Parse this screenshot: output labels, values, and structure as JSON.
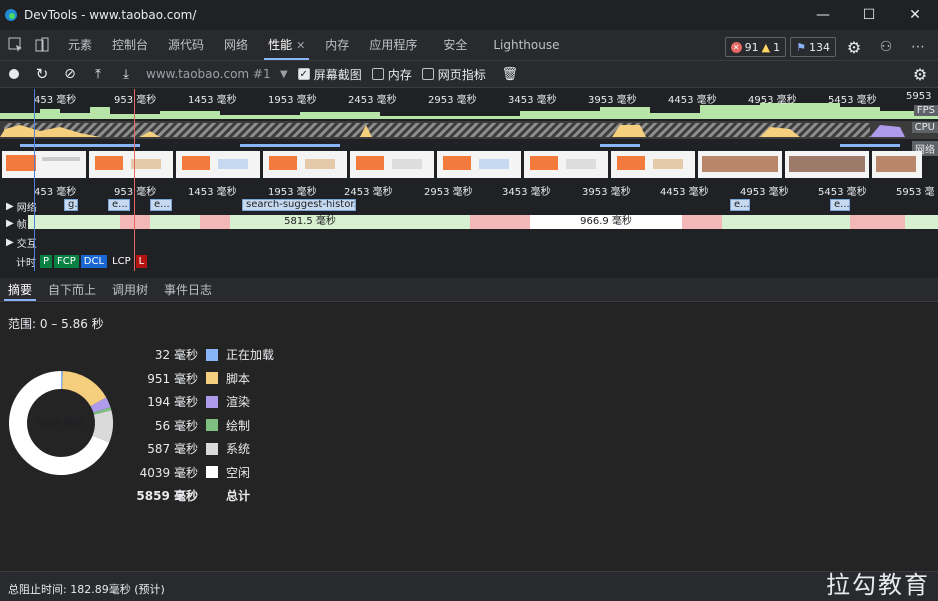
{
  "window": {
    "title": "DevTools - www.taobao.com/"
  },
  "tabs": [
    {
      "label": "元素"
    },
    {
      "label": "控制台"
    },
    {
      "label": "源代码"
    },
    {
      "label": "网络"
    },
    {
      "label": "性能"
    },
    {
      "label": "内存"
    },
    {
      "label": "应用程序"
    },
    {
      "label": "安全"
    },
    {
      "label": "Lighthouse"
    }
  ],
  "badges": {
    "errors": "91",
    "warnings": "1",
    "messages": "134"
  },
  "toolbar": {
    "profile": "www.taobao.com #1",
    "screenshots": "屏幕截图",
    "screenshots_checked": true,
    "memory": "内存",
    "memory_checked": false,
    "web_vitals": "网页指标",
    "web_vitals_checked": false
  },
  "overview": {
    "ticks": [
      "453 毫秒",
      "953 毫秒",
      "1453 毫秒",
      "1953 毫秒",
      "2453 毫秒",
      "2953 毫秒",
      "3453 毫秒",
      "3953 毫秒",
      "4453 毫秒",
      "4953 毫秒",
      "5453 毫秒",
      "5953"
    ],
    "labels": {
      "fps": "FPS",
      "cpu": "CPU",
      "net": "网络"
    }
  },
  "main": {
    "ticks": [
      "453 毫秒",
      "953 毫秒",
      "1453 毫秒",
      "1953 毫秒",
      "2453 毫秒",
      "2953 毫秒",
      "3453 毫秒",
      "3953 毫秒",
      "4453 毫秒",
      "4953 毫秒",
      "5453 毫秒",
      "5953 毫"
    ],
    "network_label": "网络",
    "network_items": [
      "g.",
      "e...",
      "e...",
      "search-suggest-histor...",
      "e...",
      "e..."
    ],
    "frames_label": "帧",
    "frame_durations": [
      "581.5 毫秒",
      "966.9 毫秒"
    ],
    "interactions_label": "交互",
    "timings_label": "计时",
    "timings": [
      "P",
      "FCP",
      "DCL",
      "LCP",
      "L"
    ]
  },
  "subtabs": [
    "摘要",
    "自下而上",
    "调用树",
    "事件日志"
  ],
  "summary": {
    "range": "范围: 0 – 5.86 秒",
    "total_label": "5859 毫秒",
    "rows": [
      {
        "value": "32 毫秒",
        "name": "正在加载",
        "color": "#8ab4f8"
      },
      {
        "value": "951 毫秒",
        "name": "脚本",
        "color": "#f5cf7e"
      },
      {
        "value": "194 毫秒",
        "name": "渲染",
        "color": "#af9bec"
      },
      {
        "value": "56 毫秒",
        "name": "绘制",
        "color": "#7fbf7f"
      },
      {
        "value": "587 毫秒",
        "name": "系统",
        "color": "#dadada"
      },
      {
        "value": "4039 毫秒",
        "name": "空闲",
        "color": "#ffffff"
      },
      {
        "value": "5859 毫秒",
        "name": "总计",
        "color": ""
      }
    ]
  },
  "status": {
    "text": "总阻止时间: 182.89毫秒 (预计)"
  },
  "watermark": "拉勾教育"
}
